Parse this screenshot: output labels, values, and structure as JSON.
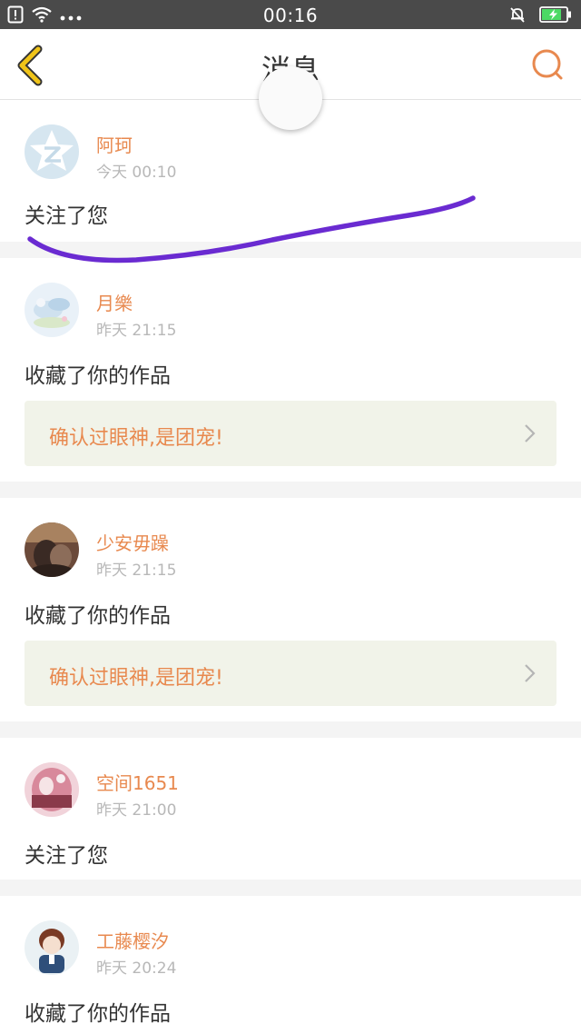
{
  "status_bar": {
    "time": "00:16",
    "left_icons": [
      "sim-alert-icon",
      "wifi-icon",
      "more-dots-icon"
    ],
    "right_icons": [
      "mute-bell-icon",
      "battery-charging-icon"
    ]
  },
  "header": {
    "title": "消息",
    "back_icon": "chevron-left-icon",
    "search_icon": "search-icon"
  },
  "colors": {
    "accent": "#e8894f",
    "back_arrow": "#f0c419",
    "work_bg": "#f1f3e9",
    "annotation_stroke": "#6a2bd1"
  },
  "messages": [
    {
      "name": "阿珂",
      "time": "今天 00:10",
      "text": "关注了您"
    },
    {
      "name": "月樂",
      "time": "昨天 21:15",
      "text": "收藏了你的作品",
      "work_title": "确认过眼神,是团宠!"
    },
    {
      "name": "少安毋躁",
      "time": "昨天 21:15",
      "text": "收藏了你的作品",
      "work_title": "确认过眼神,是团宠!"
    },
    {
      "name": "空间1651",
      "time": "昨天 21:00",
      "text": "关注了您"
    },
    {
      "name": "工藤樱汐",
      "time": "昨天 20:24",
      "text": "收藏了你的作品"
    }
  ]
}
